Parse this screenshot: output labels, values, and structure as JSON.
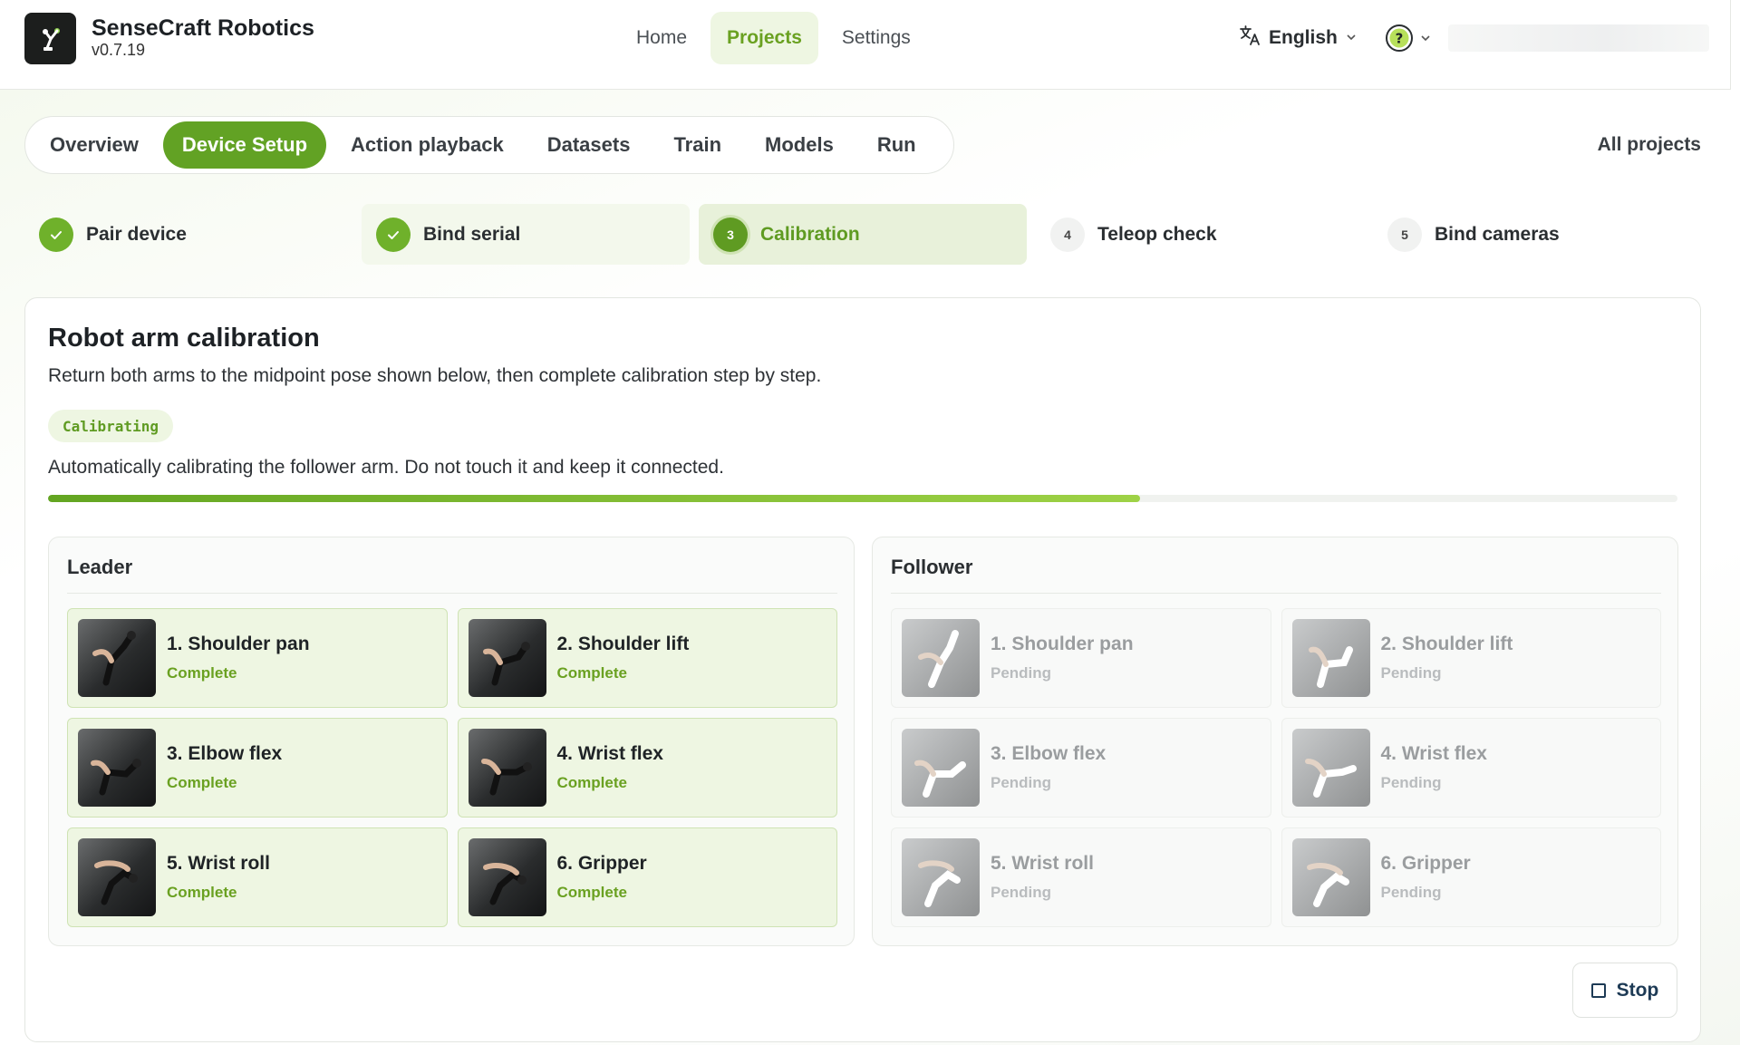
{
  "app": {
    "name": "SenseCraft Robotics",
    "version": "v0.7.19",
    "logo_icon": "robot-arm-logo-icon"
  },
  "nav": {
    "items": [
      {
        "label": "Home",
        "active": false
      },
      {
        "label": "Projects",
        "active": true
      },
      {
        "label": "Settings",
        "active": false
      }
    ]
  },
  "header": {
    "language": "English",
    "help_icon": "help-circle-icon"
  },
  "tabs": {
    "items": [
      {
        "label": "Overview",
        "active": false
      },
      {
        "label": "Device Setup",
        "active": true
      },
      {
        "label": "Action playback",
        "active": false
      },
      {
        "label": "Datasets",
        "active": false
      },
      {
        "label": "Train",
        "active": false
      },
      {
        "label": "Models",
        "active": false
      },
      {
        "label": "Run",
        "active": false
      }
    ],
    "all_projects": "All projects"
  },
  "stepper": {
    "steps": [
      {
        "label": "Pair device",
        "state": "done"
      },
      {
        "label": "Bind serial",
        "state": "done"
      },
      {
        "number": "3",
        "label": "Calibration",
        "state": "current"
      },
      {
        "number": "4",
        "label": "Teleop check",
        "state": "todo"
      },
      {
        "number": "5",
        "label": "Bind cameras",
        "state": "todo"
      }
    ]
  },
  "calibration": {
    "title": "Robot arm calibration",
    "description": "Return both arms to the midpoint pose shown below, then complete calibration step by step.",
    "status_badge": "Calibrating",
    "status_text": "Automatically calibrating the follower arm. Do not touch it and keep it connected.",
    "progress_fraction": 0.67,
    "leader": {
      "title": "Leader",
      "joints": [
        {
          "name": "1. Shoulder pan",
          "state": "Complete"
        },
        {
          "name": "2. Shoulder lift",
          "state": "Complete"
        },
        {
          "name": "3. Elbow flex",
          "state": "Complete"
        },
        {
          "name": "4. Wrist flex",
          "state": "Complete"
        },
        {
          "name": "5. Wrist roll",
          "state": "Complete"
        },
        {
          "name": "6. Gripper",
          "state": "Complete"
        }
      ]
    },
    "follower": {
      "title": "Follower",
      "joints": [
        {
          "name": "1. Shoulder pan",
          "state": "Pending"
        },
        {
          "name": "2. Shoulder lift",
          "state": "Pending"
        },
        {
          "name": "3. Elbow flex",
          "state": "Pending"
        },
        {
          "name": "4. Wrist flex",
          "state": "Pending"
        },
        {
          "name": "5. Wrist roll",
          "state": "Pending"
        },
        {
          "name": "6. Gripper",
          "state": "Pending"
        }
      ]
    },
    "stop_label": "Stop"
  },
  "colors": {
    "accent": "#62a224",
    "accent_light": "#eef6e2",
    "pending_text": "#9a9d9f"
  }
}
